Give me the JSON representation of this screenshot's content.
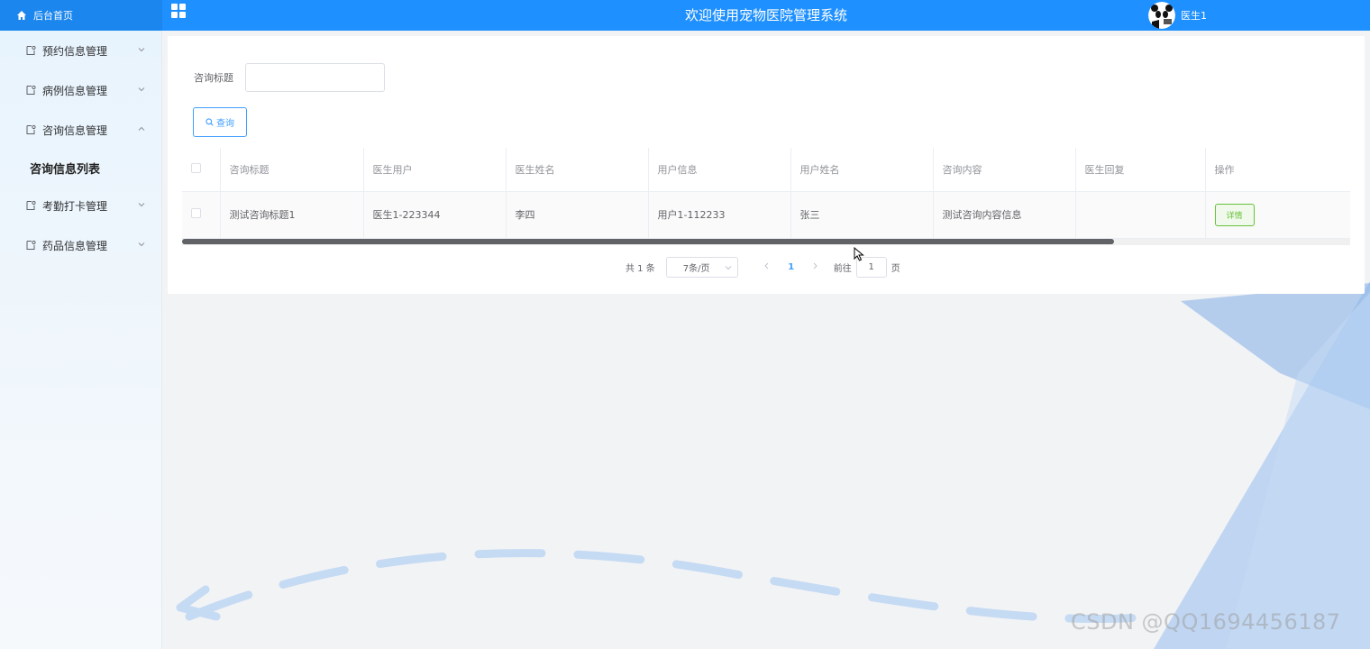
{
  "header": {
    "home_label": "后台首页",
    "title": "欢迎使用宠物医院管理系统",
    "user_name": "医生1"
  },
  "sidebar": {
    "items": [
      {
        "label": "预约信息管理",
        "expanded": false
      },
      {
        "label": "病例信息管理",
        "expanded": false
      },
      {
        "label": "咨询信息管理",
        "expanded": true
      },
      {
        "label": "考勤打卡管理",
        "expanded": false
      },
      {
        "label": "药品信息管理",
        "expanded": false
      }
    ],
    "active_sub": "咨询信息列表"
  },
  "search": {
    "label": "咨询标题",
    "value": "",
    "placeholder": "",
    "button_label": "查询"
  },
  "table": {
    "columns": [
      "咨询标题",
      "医生用户",
      "医生姓名",
      "用户信息",
      "用户姓名",
      "咨询内容",
      "医生回复",
      "操作"
    ],
    "rows": [
      {
        "title": "测试咨询标题1",
        "doctor_user": "医生1-223344",
        "doctor_name": "李四",
        "user_info": "用户1-112233",
        "user_name": "张三",
        "content": "测试咨询内容信息",
        "reply": "",
        "action_label": "详情"
      }
    ]
  },
  "pagination": {
    "total": "共 1 条",
    "page_size": "7条/页",
    "current_page": "1",
    "goto_prefix": "前往",
    "goto_value": "1",
    "goto_suffix": "页"
  },
  "watermark": "CSDN @QQ1694456187",
  "colors": {
    "header": "#1e90ff",
    "primary": "#409eff",
    "success": "#67c23a"
  }
}
